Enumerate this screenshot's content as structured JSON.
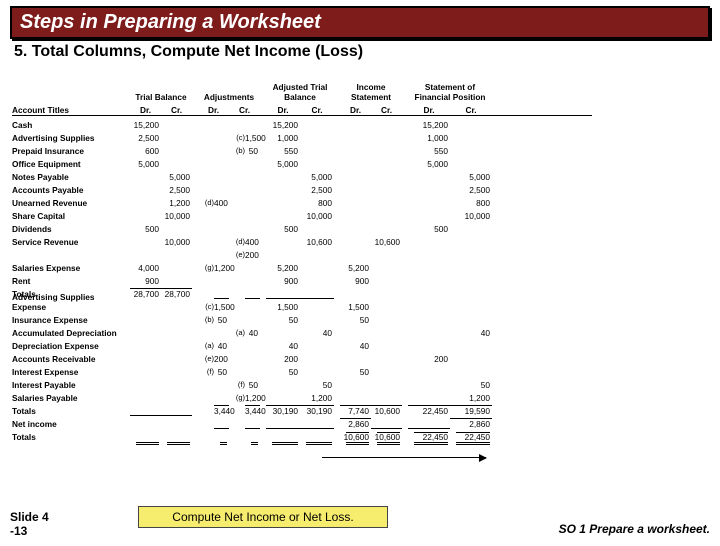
{
  "banner": "Steps in Preparing a Worksheet",
  "subtitle": "5. Total Columns, Compute Net Income (Loss)",
  "slide_label": "Slide 4\n-13",
  "so_label": "SO 1  Prepare a worksheet.",
  "callout": "Compute Net Income or Net Loss.",
  "columns": {
    "account": "Account Titles",
    "groups": [
      "Trial Balance",
      "Adjustments",
      "Adjusted Trial Balance",
      "Income Statement",
      "Statement of Financial Position"
    ],
    "sub": [
      "Dr.",
      "Cr."
    ]
  },
  "rows": [
    {
      "label": "Cash",
      "tb_dr": "15,200",
      "adj_dr": "",
      "adj_cr": "",
      "atb_dr": "15,200",
      "atb_cr": "",
      "is_dr": "",
      "is_cr": "",
      "sfp_dr": "15,200",
      "sfp_cr": ""
    },
    {
      "label": "Advertising Supplies",
      "tb_dr": "2,500",
      "adj_note_cr": "(c)",
      "adj_cr": "1,500",
      "atb_dr": "1,000",
      "sfp_dr": "1,000"
    },
    {
      "label": "Prepaid Insurance",
      "tb_dr": "600",
      "adj_note_cr": "(b)",
      "adj_cr": "50",
      "atb_dr": "550",
      "sfp_dr": "550"
    },
    {
      "label": "Office Equipment",
      "tb_dr": "5,000",
      "atb_dr": "5,000",
      "sfp_dr": "5,000"
    },
    {
      "label": "Notes Payable",
      "tb_cr": "5,000",
      "atb_cr": "5,000",
      "sfp_cr": "5,000"
    },
    {
      "label": "Accounts Payable",
      "tb_cr": "2,500",
      "atb_cr": "2,500",
      "sfp_cr": "2,500"
    },
    {
      "label": "Unearned Revenue",
      "tb_cr": "1,200",
      "adj_note_dr": "(d)",
      "adj_dr": "400",
      "atb_cr": "800",
      "sfp_cr": "800"
    },
    {
      "label": "Share Capital",
      "tb_cr": "10,000",
      "atb_cr": "10,000",
      "sfp_cr": "10,000"
    },
    {
      "label": "Dividends",
      "tb_dr": "500",
      "atb_dr": "500",
      "sfp_dr": "500"
    },
    {
      "label": "Service Revenue",
      "tb_cr": "10,000",
      "adj_note_cr": "(d)",
      "adj_cr": "400",
      "atb_cr": "10,600",
      "is_cr": "10,600"
    },
    {
      "label": "",
      "adj_note_cr": "(e)",
      "adj_cr": "200"
    },
    {
      "label": "Salaries Expense",
      "tb_dr": "4,000",
      "adj_note_dr": "(g)",
      "adj_dr": "1,200",
      "atb_dr": "5,200",
      "is_dr": "5,200"
    },
    {
      "label": "Rent",
      "tb_dr": "900",
      "atb_dr": "900",
      "is_dr": "900"
    },
    {
      "label": "  Totals",
      "tb_dr": "28,700",
      "tb_cr": "28,700",
      "totals": true
    },
    {
      "label": "Advertising Supplies Expense",
      "adj_note_dr": "(c)",
      "adj_dr": "1,500",
      "atb_dr": "1,500",
      "is_dr": "1,500"
    },
    {
      "label": "Insurance Expense",
      "adj_note_dr": "(b)",
      "adj_dr": "50",
      "atb_dr": "50",
      "is_dr": "50"
    },
    {
      "label": "Accumulated Depreciation",
      "adj_note_cr": "(a)",
      "adj_cr": "40",
      "atb_cr": "40",
      "sfp_cr": "40"
    },
    {
      "label": "Depreciation Expense",
      "adj_note_dr": "(a)",
      "adj_dr": "40",
      "atb_dr": "40",
      "is_dr": "40"
    },
    {
      "label": "Accounts Receivable",
      "adj_note_dr": "(e)",
      "adj_dr": "200",
      "atb_dr": "200",
      "sfp_dr": "200"
    },
    {
      "label": "Interest Expense",
      "adj_note_dr": "(f)",
      "adj_dr": "50",
      "atb_dr": "50",
      "is_dr": "50"
    },
    {
      "label": "Interest Payable",
      "adj_note_cr": "(f)",
      "adj_cr": "50",
      "atb_cr": "50",
      "sfp_cr": "50"
    },
    {
      "label": "Salaries Payable",
      "adj_note_cr": "(g)",
      "adj_cr": "1,200",
      "atb_cr": "1,200",
      "sfp_cr": "1,200"
    },
    {
      "label": "  Totals",
      "adj_dr": "3,440",
      "adj_cr": "3,440",
      "atb_dr": "30,190",
      "atb_cr": "30,190",
      "is_dr": "7,740",
      "is_cr": "10,600",
      "sfp_dr": "22,450",
      "sfp_cr": "19,590",
      "totals": true,
      "underline": true
    },
    {
      "label": " Net income",
      "is_dr": "2,860",
      "sfp_cr": "2,860",
      "underline": true
    },
    {
      "label": "  Totals",
      "is_dr": "10,600",
      "is_cr": "10,600",
      "sfp_dr": "22,450",
      "sfp_cr": "22,450",
      "double": true
    }
  ]
}
